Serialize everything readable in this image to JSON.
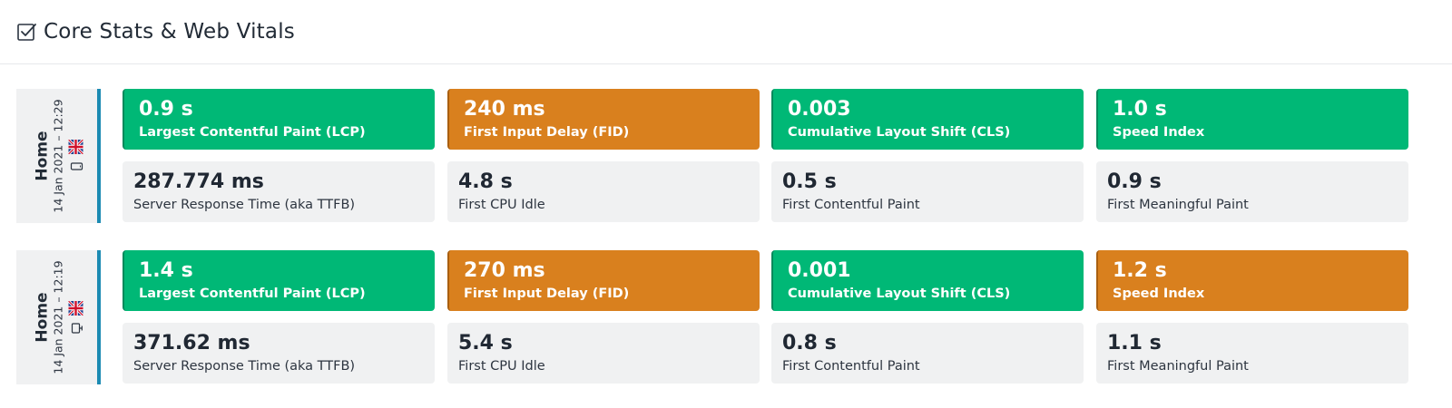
{
  "header": {
    "title": "Core Stats & Web Vitals",
    "icon": "checkbox-checked-icon"
  },
  "colors": {
    "good": "#00b876",
    "needs_improvement": "#d9801e",
    "accent_border": "#1c8bb3",
    "neutral_tile": "#f0f1f2"
  },
  "rows": [
    {
      "page": "Home",
      "timestamp": "14 Jan 2021 – 12:29",
      "device_icon": "mobile-icon",
      "flag_icon": "uk-flag-icon",
      "vitals": [
        {
          "value": "0.9 s",
          "label": "Largest Contentful Paint (LCP)",
          "status": "good"
        },
        {
          "value": "240 ms",
          "label": "First Input Delay (FID)",
          "status": "warn"
        },
        {
          "value": "0.003",
          "label": "Cumulative Layout Shift (CLS)",
          "status": "good"
        },
        {
          "value": "1.0 s",
          "label": "Speed Index",
          "status": "good"
        }
      ],
      "stats": [
        {
          "value": "287.774 ms",
          "label": "Server Response Time (aka TTFB)"
        },
        {
          "value": "4.8 s",
          "label": "First CPU Idle"
        },
        {
          "value": "0.5 s",
          "label": "First Contentful Paint"
        },
        {
          "value": "0.9 s",
          "label": "First Meaningful Paint"
        }
      ]
    },
    {
      "page": "Home",
      "timestamp": "14 Jan 2021 – 12:19",
      "device_icon": "desktop-icon",
      "flag_icon": "uk-flag-icon",
      "vitals": [
        {
          "value": "1.4 s",
          "label": "Largest Contentful Paint (LCP)",
          "status": "good"
        },
        {
          "value": "270 ms",
          "label": "First Input Delay (FID)",
          "status": "warn"
        },
        {
          "value": "0.001",
          "label": "Cumulative Layout Shift (CLS)",
          "status": "good"
        },
        {
          "value": "1.2 s",
          "label": "Speed Index",
          "status": "warn"
        }
      ],
      "stats": [
        {
          "value": "371.62 ms",
          "label": "Server Response Time (aka TTFB)"
        },
        {
          "value": "5.4 s",
          "label": "First CPU Idle"
        },
        {
          "value": "0.8 s",
          "label": "First Contentful Paint"
        },
        {
          "value": "1.1 s",
          "label": "First Meaningful Paint"
        }
      ]
    }
  ]
}
